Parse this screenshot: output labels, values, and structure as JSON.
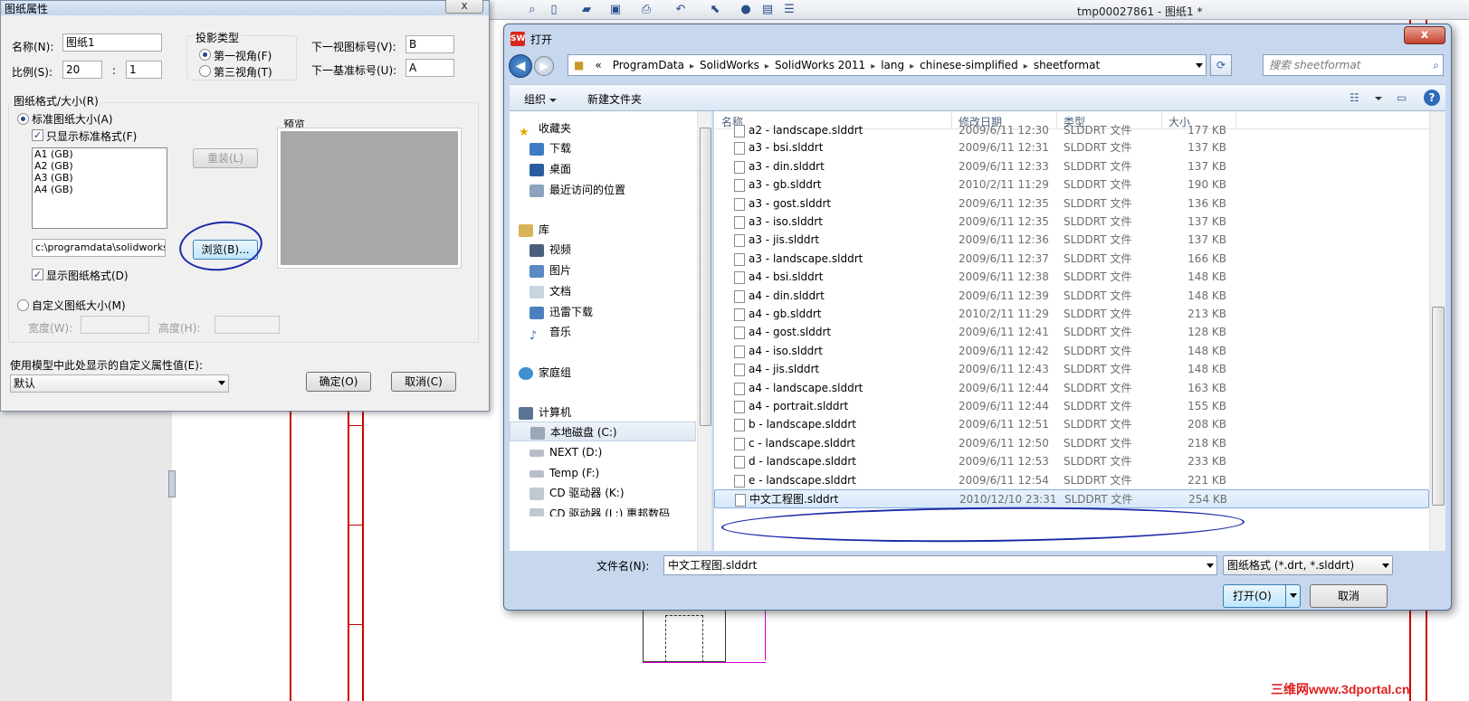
{
  "app": {
    "window_title": "tmp00027861 - 图纸1 *",
    "watermark": "三维网www.3dportal.cn"
  },
  "sheet_dialog": {
    "title": "图纸属性",
    "close_label": "x",
    "name_label": "名称(N):",
    "name_value": "图纸1",
    "scale_label": "比例(S):",
    "scale_num": "20",
    "scale_colon": ":",
    "scale_den": "1",
    "projection_group": "投影类型",
    "first_angle": "第一视角(F)",
    "third_angle": "第三视角(T)",
    "next_view_label": "下一视图标号(V):",
    "next_view_value": "B",
    "next_datum_label": "下一基准标号(U):",
    "next_datum_value": "A",
    "format_group": "图纸格式/大小(R)",
    "standard_size": "标准图纸大小(A)",
    "only_standard": "只显示标准格式(F)",
    "sheet_sizes": [
      "A1 (GB)",
      "A2 (GB)",
      "A3 (GB)",
      "A4 (GB)"
    ],
    "reload_button": "重装(L)",
    "preview_label": "预览",
    "path_value": "c:\\programdata\\solidworks\\so",
    "browse_button": "浏览(B)...",
    "show_format": "显示图纸格式(D)",
    "custom_size": "自定义图纸大小(M)",
    "width_label": "宽度(W):",
    "height_label": "高度(H):",
    "custom_prop_label": "使用模型中此处显示的自定义属性值(E):",
    "custom_prop_value": "默认",
    "ok_button": "确定(O)",
    "cancel_button": "取消(C)"
  },
  "open_dialog": {
    "icon_text": "SW",
    "title": "打开",
    "close_label": "x",
    "breadcrumbs": [
      "ProgramData",
      "SolidWorks",
      "SolidWorks 2011",
      "lang",
      "chinese-simplified",
      "sheetformat"
    ],
    "crumb_root": "«",
    "search_placeholder": "搜索 sheetformat",
    "organize": "组织",
    "new_folder": "新建文件夹",
    "nav": {
      "favorites": "收藏夹",
      "downloads": "下载",
      "desktop": "桌面",
      "recent": "最近访问的位置",
      "libraries": "库",
      "videos": "视频",
      "pictures": "图片",
      "documents": "文档",
      "thunder": "迅雷下载",
      "music": "音乐",
      "homegroup": "家庭组",
      "computer": "计算机",
      "drive_c": "本地磁盘 (C:)",
      "drive_d": "NEXT (D:)",
      "drive_f": "Temp (F:)",
      "drive_k": "CD 驱动器 (K:)",
      "drive_l": "CD 驱动器 (L:) 惠邦数码"
    },
    "columns": {
      "name": "名称",
      "date": "修改日期",
      "type": "类型",
      "size": "大小"
    },
    "files": [
      {
        "name": "a2 - landscape.slddrt",
        "date": "2009/6/11 12:30",
        "type": "SLDDRT 文件",
        "size": "177 KB"
      },
      {
        "name": "a3 - bsi.slddrt",
        "date": "2009/6/11 12:31",
        "type": "SLDDRT 文件",
        "size": "137 KB"
      },
      {
        "name": "a3 - din.slddrt",
        "date": "2009/6/11 12:33",
        "type": "SLDDRT 文件",
        "size": "137 KB"
      },
      {
        "name": "a3 - gb.slddrt",
        "date": "2010/2/11 11:29",
        "type": "SLDDRT 文件",
        "size": "190 KB"
      },
      {
        "name": "a3 - gost.slddrt",
        "date": "2009/6/11 12:35",
        "type": "SLDDRT 文件",
        "size": "136 KB"
      },
      {
        "name": "a3 - iso.slddrt",
        "date": "2009/6/11 12:35",
        "type": "SLDDRT 文件",
        "size": "137 KB"
      },
      {
        "name": "a3 - jis.slddrt",
        "date": "2009/6/11 12:36",
        "type": "SLDDRT 文件",
        "size": "137 KB"
      },
      {
        "name": "a3 - landscape.slddrt",
        "date": "2009/6/11 12:37",
        "type": "SLDDRT 文件",
        "size": "166 KB"
      },
      {
        "name": "a4 - bsi.slddrt",
        "date": "2009/6/11 12:38",
        "type": "SLDDRT 文件",
        "size": "148 KB"
      },
      {
        "name": "a4 - din.slddrt",
        "date": "2009/6/11 12:39",
        "type": "SLDDRT 文件",
        "size": "148 KB"
      },
      {
        "name": "a4 - gb.slddrt",
        "date": "2010/2/11 11:29",
        "type": "SLDDRT 文件",
        "size": "213 KB"
      },
      {
        "name": "a4 - gost.slddrt",
        "date": "2009/6/11 12:41",
        "type": "SLDDRT 文件",
        "size": "128 KB"
      },
      {
        "name": "a4 - iso.slddrt",
        "date": "2009/6/11 12:42",
        "type": "SLDDRT 文件",
        "size": "148 KB"
      },
      {
        "name": "a4 - jis.slddrt",
        "date": "2009/6/11 12:43",
        "type": "SLDDRT 文件",
        "size": "148 KB"
      },
      {
        "name": "a4 - landscape.slddrt",
        "date": "2009/6/11 12:44",
        "type": "SLDDRT 文件",
        "size": "163 KB"
      },
      {
        "name": "a4 - portrait.slddrt",
        "date": "2009/6/11 12:44",
        "type": "SLDDRT 文件",
        "size": "155 KB"
      },
      {
        "name": "b - landscape.slddrt",
        "date": "2009/6/11 12:51",
        "type": "SLDDRT 文件",
        "size": "208 KB"
      },
      {
        "name": "c - landscape.slddrt",
        "date": "2009/6/11 12:50",
        "type": "SLDDRT 文件",
        "size": "218 KB"
      },
      {
        "name": "d - landscape.slddrt",
        "date": "2009/6/11 12:53",
        "type": "SLDDRT 文件",
        "size": "233 KB"
      },
      {
        "name": "e - landscape.slddrt",
        "date": "2009/6/11 12:54",
        "type": "SLDDRT 文件",
        "size": "221 KB"
      },
      {
        "name": "中文工程图.slddrt",
        "date": "2010/12/10 23:31",
        "type": "SLDDRT 文件",
        "size": "254 KB"
      }
    ],
    "filename_label": "文件名(N):",
    "filename_value": "中文工程图.slddrt",
    "filter_value": "图纸格式 (*.drt, *.slddrt)",
    "open_button": "打开(O)",
    "cancel_button": "取消"
  },
  "colors": {
    "accent": "#1f4a8a",
    "sheet_border": "#cc0000",
    "annotation_ink": "#1b2aa8"
  }
}
